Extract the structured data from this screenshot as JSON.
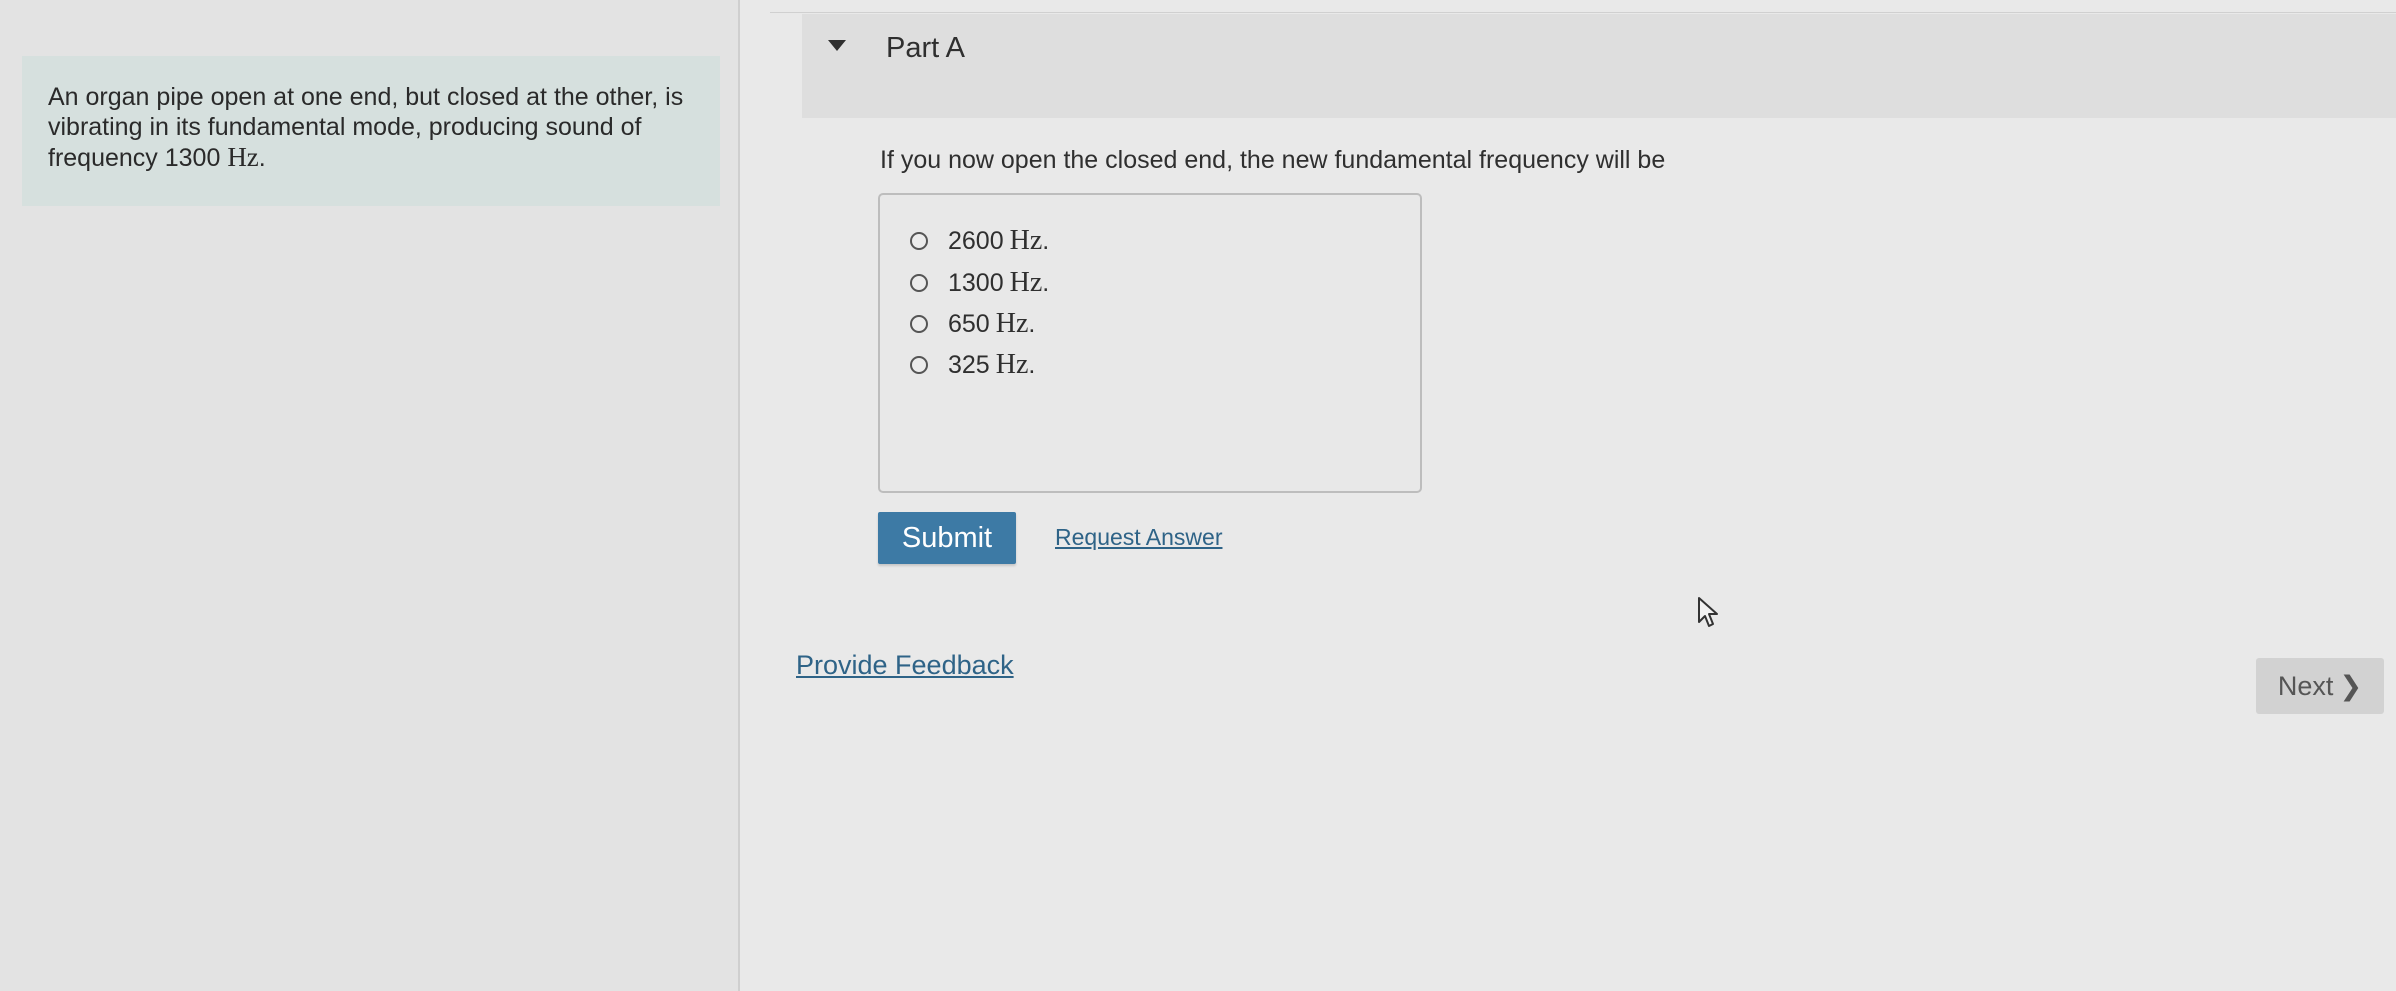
{
  "intro": {
    "text": "An organ pipe open at one end, but closed at the other, is vibrating in its fundamental mode, producing sound of frequency 1300",
    "unit": "Hz",
    "end": "."
  },
  "part": {
    "title": "Part A",
    "question": "If you now open the closed end, the new fundamental frequency will be"
  },
  "options": [
    {
      "value": "2600",
      "unit": "Hz",
      "end": "."
    },
    {
      "value": "1300",
      "unit": "Hz",
      "end": "."
    },
    {
      "value": "650",
      "unit": "Hz",
      "end": "."
    },
    {
      "value": "325",
      "unit": "Hz",
      "end": "."
    }
  ],
  "actions": {
    "submit": "Submit",
    "request_answer": "Request Answer",
    "provide_feedback": "Provide Feedback",
    "next": "Next",
    "next_chevron": "❯"
  },
  "colors": {
    "submit_bg": "#3d7aa5",
    "link": "#2e6387",
    "intro_bg": "#d6e0de"
  },
  "icons": {
    "caret": "caret-down-icon",
    "next_chevron": "chevron-right-icon",
    "cursor": "mouse-pointer-icon"
  }
}
